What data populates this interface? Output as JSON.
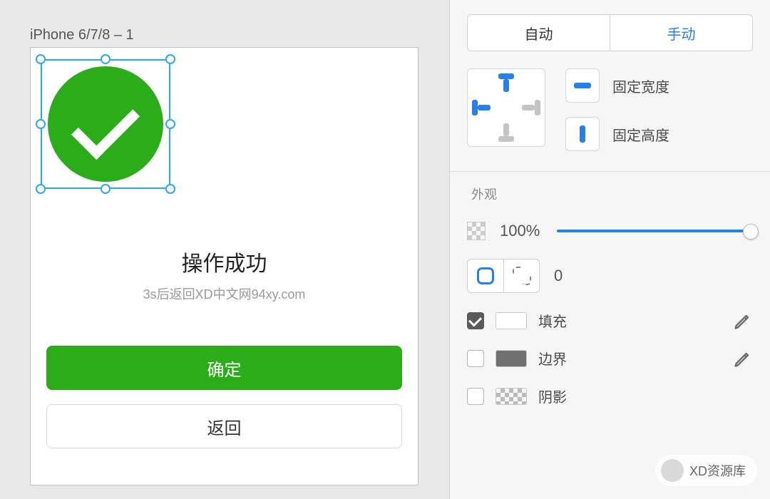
{
  "canvas": {
    "artboard_label": "iPhone 6/7/8 – 1",
    "title": "操作成功",
    "subtitle": "3s后返回XD中文网94xy.com",
    "primary_button": "确定",
    "secondary_button": "返回"
  },
  "inspector": {
    "segmented": {
      "auto": "自动",
      "manual": "手动",
      "active": "manual"
    },
    "constraints": {
      "fixed_width": "固定宽度",
      "fixed_height": "固定高度"
    },
    "appearance": {
      "section": "外观",
      "opacity": "100%",
      "corner_radius": "0",
      "fill_label": "填充",
      "border_label": "边界",
      "shadow_label": "阴影",
      "fill_checked": true,
      "border_checked": false,
      "shadow_checked": false,
      "fill_color": "#ffffff",
      "border_color": "#6f6f6f"
    }
  },
  "watermark": {
    "text": "XD资源库"
  }
}
